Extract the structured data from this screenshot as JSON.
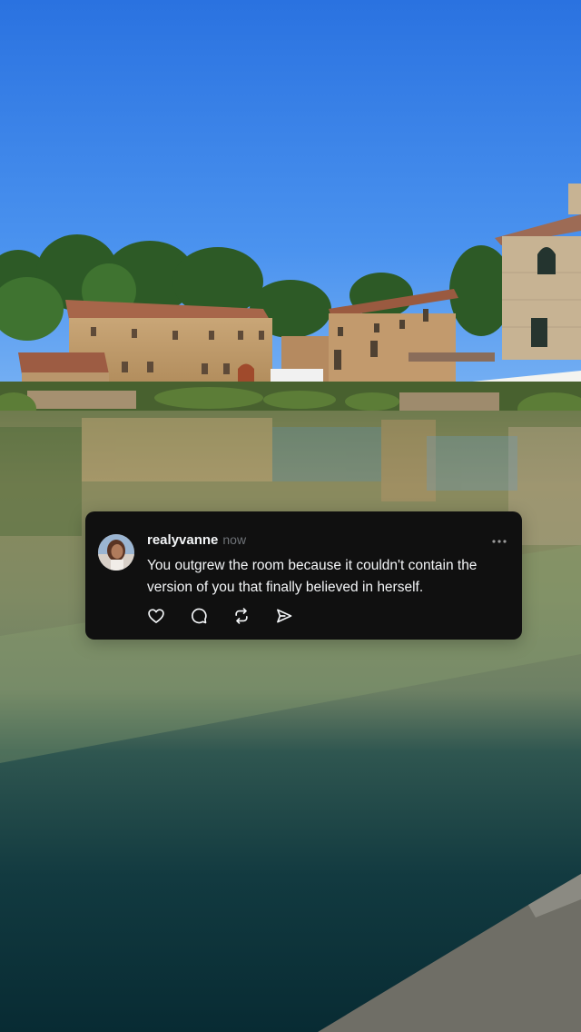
{
  "post": {
    "username": "realyvanne",
    "timestamp": "now",
    "text": "You outgrew the room because it couldn't contain the version of you that finally believed in herself.",
    "actions": [
      {
        "name": "like",
        "icon": "heart-icon"
      },
      {
        "name": "reply",
        "icon": "comment-icon"
      },
      {
        "name": "repost",
        "icon": "repost-icon"
      },
      {
        "name": "share",
        "icon": "send-icon"
      }
    ],
    "more_icon": "more-icon"
  },
  "colors": {
    "card_background": "#101010",
    "primary_text": "#f3f5f7",
    "secondary_text": "#6f7378",
    "sky": "#2f7ae6"
  }
}
